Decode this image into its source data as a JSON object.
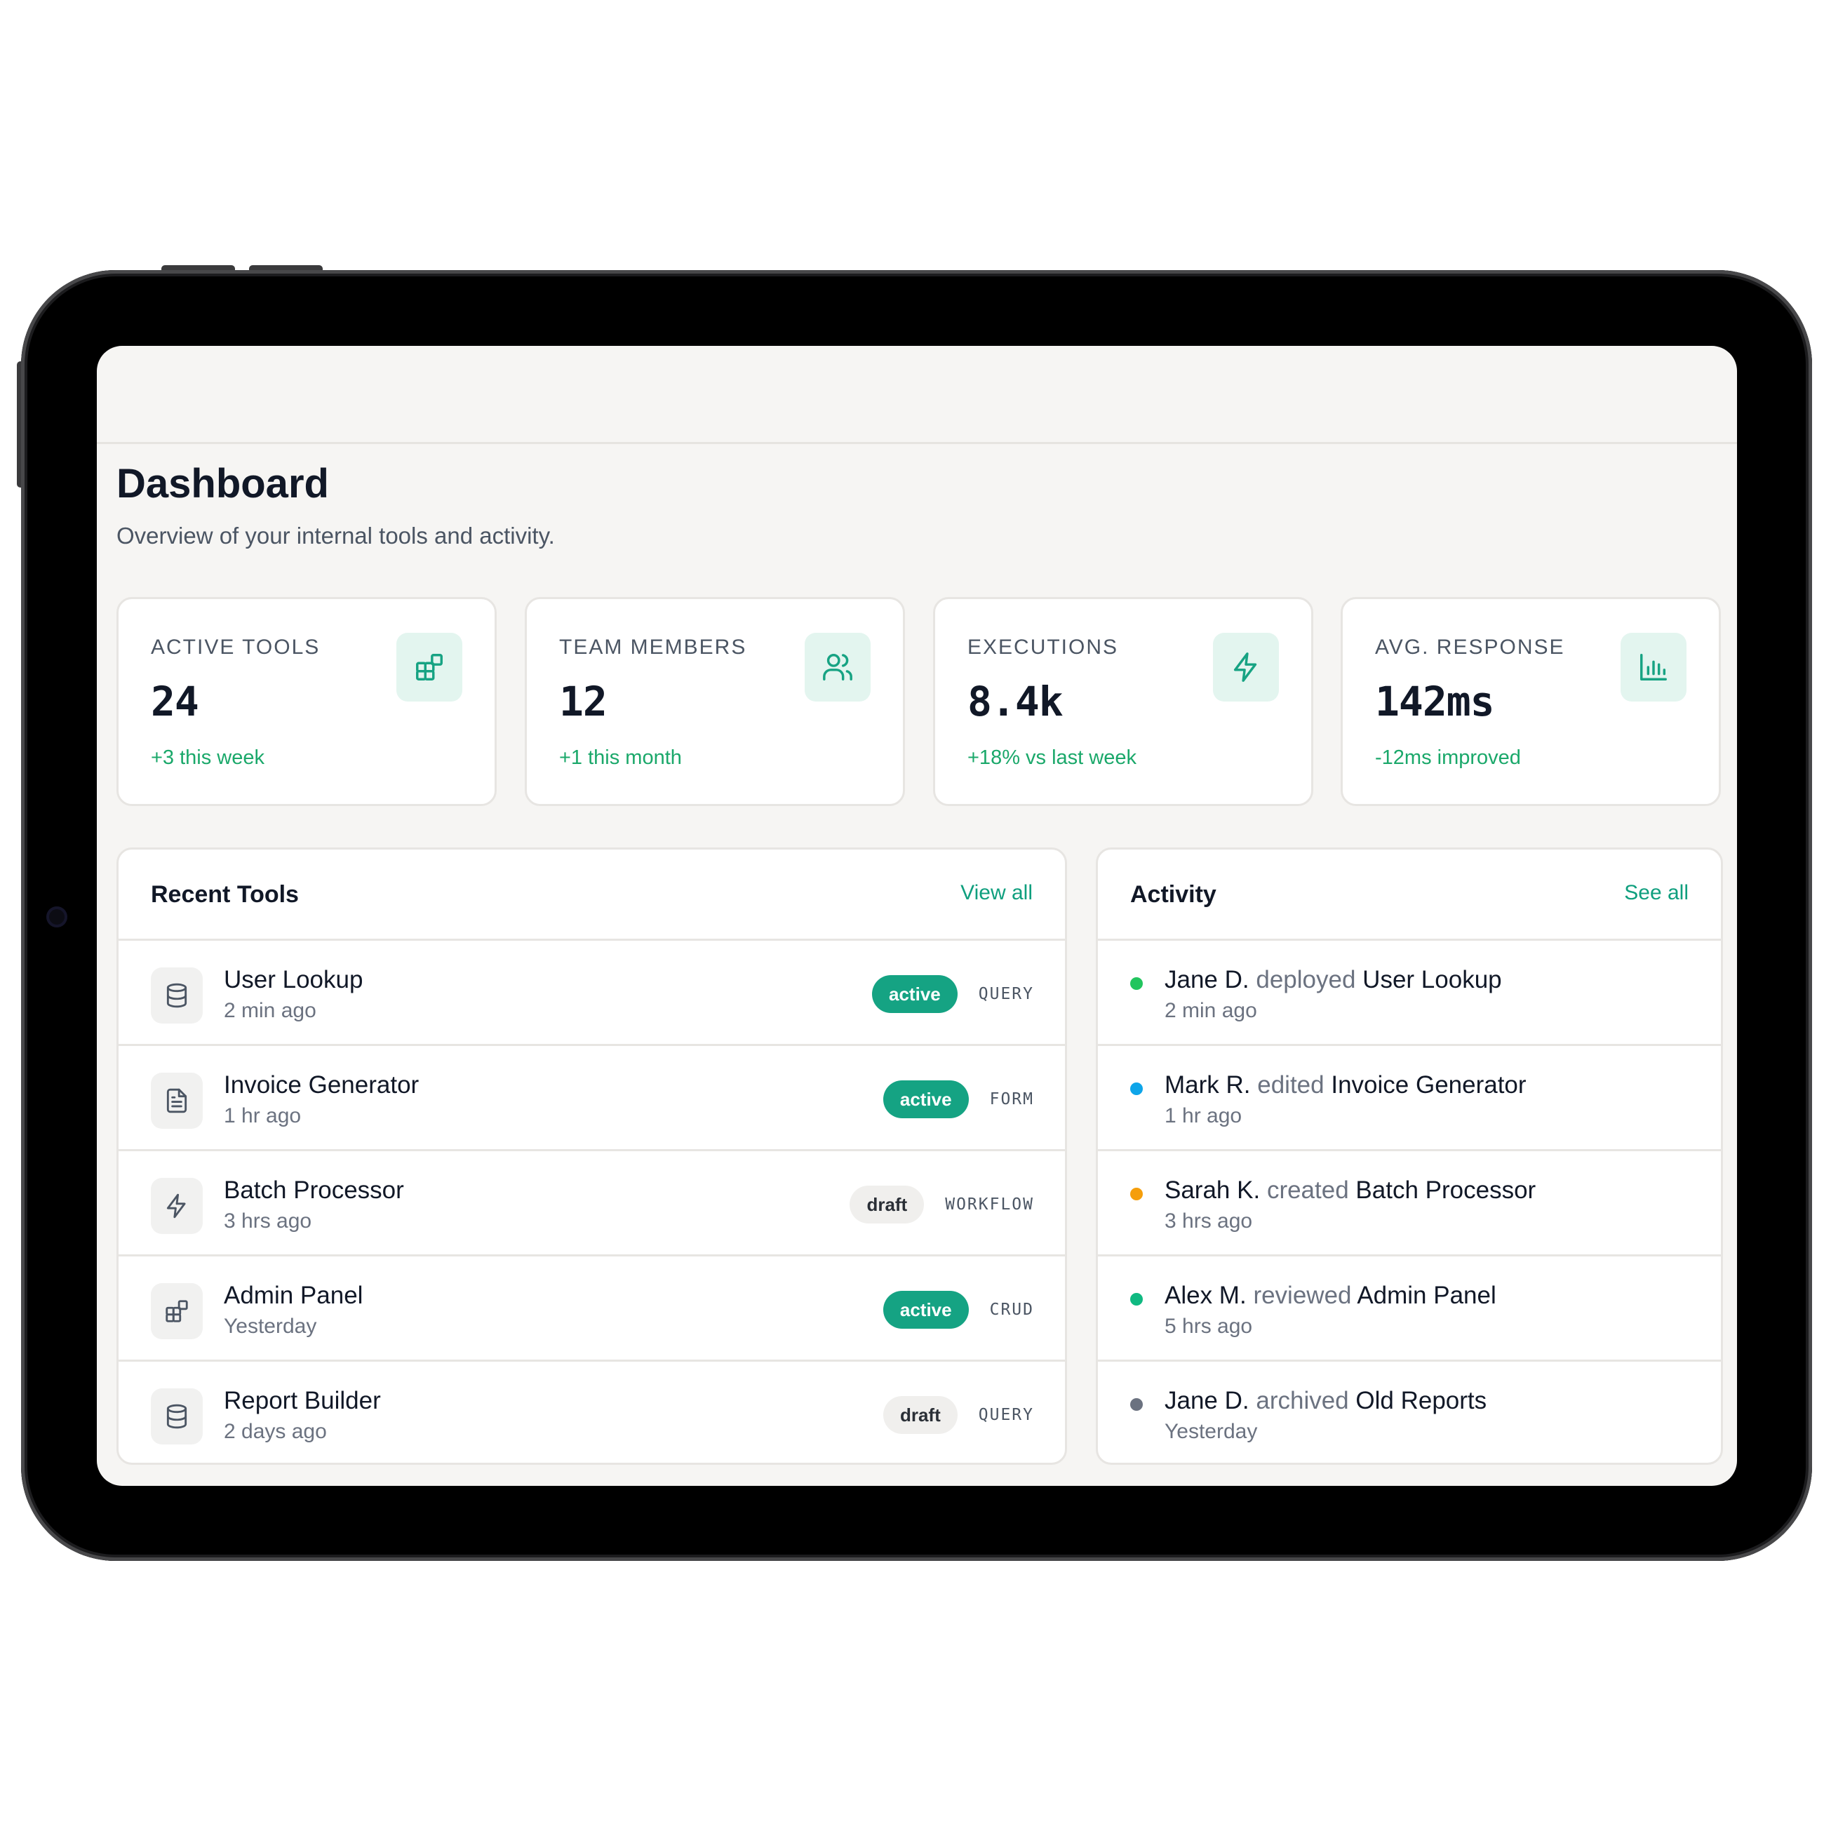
{
  "page": {
    "title": "Dashboard",
    "subtitle": "Overview of your internal tools and activity."
  },
  "stats": [
    {
      "label": "ACTIVE TOOLS",
      "value": "24",
      "delta": "+3 this week",
      "icon": "grid-icon"
    },
    {
      "label": "TEAM MEMBERS",
      "value": "12",
      "delta": "+1 this month",
      "icon": "users-icon"
    },
    {
      "label": "EXECUTIONS",
      "value": "8.4k",
      "delta": "+18% vs last week",
      "icon": "bolt-icon"
    },
    {
      "label": "AVG. RESPONSE",
      "value": "142ms",
      "delta": "-12ms improved",
      "icon": "bar-chart-icon"
    }
  ],
  "recent_tools": {
    "title": "Recent Tools",
    "link": "View all",
    "items": [
      {
        "name": "User Lookup",
        "time": "2 min ago",
        "status": "active",
        "type": "QUERY",
        "icon": "database-icon"
      },
      {
        "name": "Invoice Generator",
        "time": "1 hr ago",
        "status": "active",
        "type": "FORM",
        "icon": "document-icon"
      },
      {
        "name": "Batch Processor",
        "time": "3 hrs ago",
        "status": "draft",
        "type": "WORKFLOW",
        "icon": "bolt-icon"
      },
      {
        "name": "Admin Panel",
        "time": "Yesterday",
        "status": "active",
        "type": "CRUD",
        "icon": "grid-icon"
      },
      {
        "name": "Report Builder",
        "time": "2 days ago",
        "status": "draft",
        "type": "QUERY",
        "icon": "database-icon"
      }
    ]
  },
  "activity": {
    "title": "Activity",
    "link": "See all",
    "items": [
      {
        "user": "Jane D.",
        "verb": "deployed",
        "target": "User Lookup",
        "time": "2 min ago",
        "dot_color": "#22c55e"
      },
      {
        "user": "Mark R.",
        "verb": "edited",
        "target": "Invoice Generator",
        "time": "1 hr ago",
        "dot_color": "#0ea5e9"
      },
      {
        "user": "Sarah K.",
        "verb": "created",
        "target": "Batch Processor",
        "time": "3 hrs ago",
        "dot_color": "#f59e0b"
      },
      {
        "user": "Alex M.",
        "verb": "reviewed",
        "target": "Admin Panel",
        "time": "5 hrs ago",
        "dot_color": "#10b981"
      },
      {
        "user": "Jane D.",
        "verb": "archived",
        "target": "Old Reports",
        "time": "Yesterday",
        "dot_color": "#6b7280"
      }
    ]
  },
  "colors": {
    "accent": "#15a383",
    "positive": "#1aa86a",
    "icon_tint": "#e3f5ef",
    "background": "#f6f5f3"
  }
}
